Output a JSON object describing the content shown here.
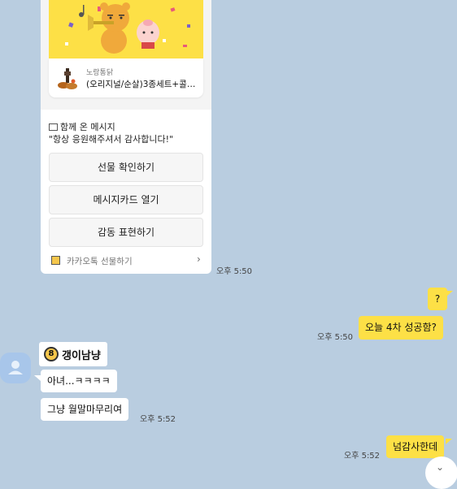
{
  "gift_card": {
    "product": {
      "brand": "노랑통닭",
      "name": "(오리지널/순살)3종세트+콜라..."
    },
    "message_label": "함께 온 메시지",
    "message_text": "\"항상 응원해주셔서 감사합니다!\"",
    "buttons": [
      "선물 확인하기",
      "메시지카드 열기",
      "감동 표현하기"
    ],
    "footer": "카카오톡 선물하기"
  },
  "messages": {
    "gift_time": "오후 5:50",
    "me_question": "?",
    "me_text": "오늘 4차 성공함?",
    "me_time": "오후 5:50",
    "sender_name": "갱이남냥",
    "sender_badge": "8",
    "reply1": "아녀...ㅋㅋㅋㅋ",
    "reply2": "그냥 월말마무리여",
    "reply_time": "오후 5:52",
    "me_thanks": "넘감사한데",
    "thanks_time": "오후 5:52"
  },
  "colors": {
    "chat_background": "#b9cde0",
    "my_bubble": "#fde046",
    "their_bubble": "#ffffff"
  }
}
